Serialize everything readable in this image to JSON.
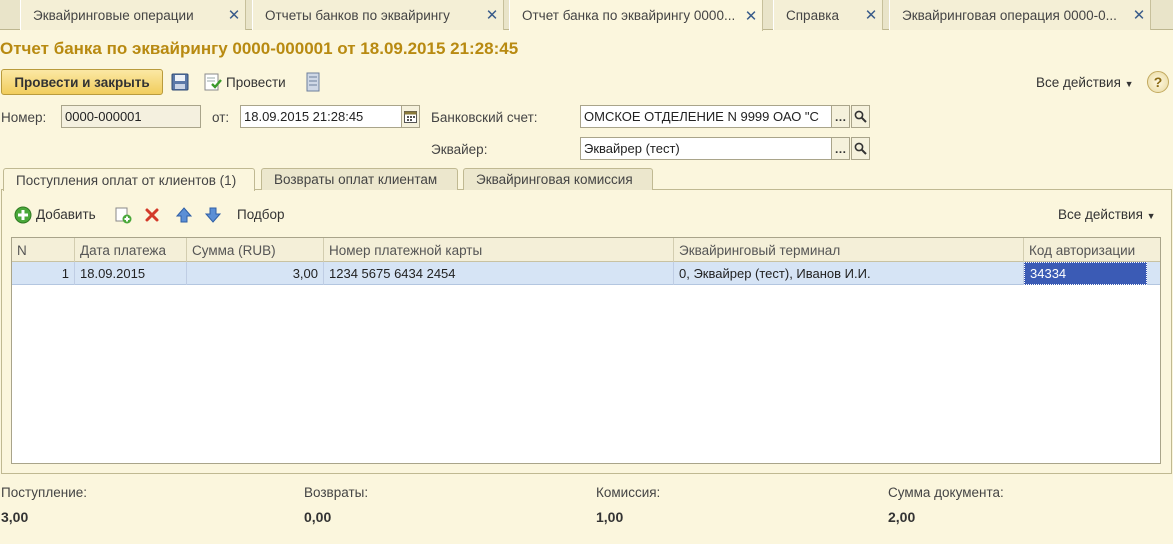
{
  "tabs": [
    {
      "label": "Эквайринговые операции"
    },
    {
      "label": "Отчеты банков по эквайрингу"
    },
    {
      "label": "Отчет банка по эквайрингу 0000..."
    },
    {
      "label": "Справка"
    },
    {
      "label": "Эквайринговая операция 0000-0..."
    }
  ],
  "title": "Отчет банка по эквайрингу 0000-000001 от 18.09.2015 21:28:45",
  "toolbar": {
    "post_close": "Провести и закрыть",
    "post": "Провести",
    "all_actions": "Все действия"
  },
  "form": {
    "number_label": "Номер:",
    "number_value": "0000-000001",
    "from_label": "от:",
    "date_value": "18.09.2015 21:28:45",
    "bank_account_label": "Банковский счет:",
    "bank_account_value": "ОМСКОЕ ОТДЕЛЕНИЕ N 9999 ОАО \"С",
    "acquirer_label": "Эквайер:",
    "acquirer_value": "Эквайрер (тест)"
  },
  "inner_tabs": [
    {
      "label": "Поступления оплат от клиентов (1)"
    },
    {
      "label": "Возвраты оплат клиентам"
    },
    {
      "label": "Эквайринговая комиссия"
    }
  ],
  "grid_toolbar": {
    "add": "Добавить",
    "selection": "Подбор",
    "all_actions": "Все действия"
  },
  "table": {
    "columns": [
      "N",
      "Дата платежа",
      "Сумма (RUB)",
      "Номер платежной карты",
      "Эквайринговый терминал",
      "Код авторизации"
    ],
    "rows": [
      [
        "1",
        "18.09.2015",
        "3,00",
        "1234 5675 6434 2454",
        "0, Эквайрер (тест), Иванов И.И.",
        "34334"
      ]
    ]
  },
  "totals": {
    "income_label": "Поступление:",
    "income_value": "3,00",
    "returns_label": "Возвраты:",
    "returns_value": "0,00",
    "commission_label": "Комиссия:",
    "commission_value": "1,00",
    "doc_sum_label": "Сумма документа:",
    "doc_sum_value": "2,00"
  },
  "colors": {
    "title": "#b88a11",
    "selection": "#3b5bb5",
    "row_highlight": "#d6e4f5"
  }
}
